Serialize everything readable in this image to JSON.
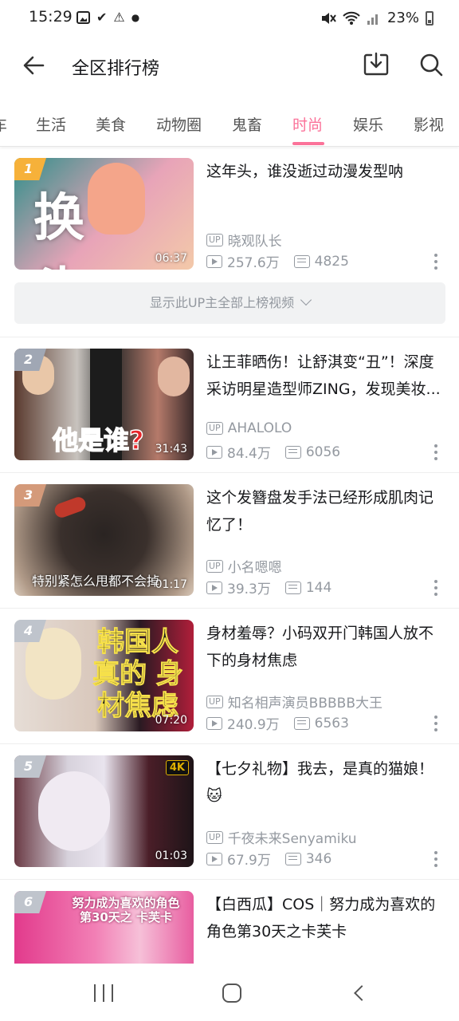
{
  "status_bar": {
    "time": "15:29",
    "battery": "23%",
    "icons": [
      "image-icon",
      "check-icon",
      "warning-icon",
      "dot-icon",
      "mute-icon",
      "wifi-icon",
      "signal-icon",
      "battery-icon"
    ]
  },
  "header": {
    "title": "全区排行榜"
  },
  "tabs": [
    {
      "label": "车",
      "active": false
    },
    {
      "label": "生活",
      "active": false
    },
    {
      "label": "美食",
      "active": false
    },
    {
      "label": "动物圈",
      "active": false
    },
    {
      "label": "鬼畜",
      "active": false
    },
    {
      "label": "时尚",
      "active": true
    },
    {
      "label": "娱乐",
      "active": false
    },
    {
      "label": "影视",
      "active": false
    }
  ],
  "show_all_label": "显示此UP主全部上榜视频",
  "up_badge": "UP",
  "videos": [
    {
      "rank": "1",
      "title": "这年头，谁没逝过动漫发型呐",
      "uploader": "晓观队长",
      "views": "257.6万",
      "danmaku": "4825",
      "duration": "06:37",
      "overlay_text": "换 头",
      "rank_color": "#f6b13a"
    },
    {
      "rank": "2",
      "title": "让王菲晒伤！让舒淇变“丑”！深度采访明星造型师ZING，发现美妆...",
      "uploader": "AHALOLO",
      "views": "84.4万",
      "danmaku": "6056",
      "duration": "31:43",
      "overlay_text": "他是谁?",
      "rank_color": "#a0a7b4"
    },
    {
      "rank": "3",
      "title": "这个发簪盘发手法已经形成肌肉记忆了！",
      "uploader": "小名嗯嗯",
      "views": "39.3万",
      "danmaku": "144",
      "duration": "01:17",
      "overlay_text": "特别紧怎么甩都不会掉",
      "rank_color": "#d49a7a"
    },
    {
      "rank": "4",
      "title": "身材羞辱？小码双开门韩国人放不下的身材焦虑",
      "uploader": "知名相声演员BBBBB大王",
      "views": "240.9万",
      "danmaku": "6563",
      "duration": "07:20",
      "overlay_text": "韩国人 真的 身材焦虑",
      "rank_color": "#bfc4cc"
    },
    {
      "rank": "5",
      "title": "【七夕礼物】我去，是真的猫娘！🐱",
      "uploader": "千夜未来Senyamiku",
      "views": "67.9万",
      "danmaku": "346",
      "duration": "01:03",
      "overlay_text": "4K",
      "rank_color": "#bfc4cc"
    },
    {
      "rank": "6",
      "title": "【白西瓜】COS｜努力成为喜欢的角色第30天之卡芙卡",
      "uploader": "",
      "views": "",
      "danmaku": "",
      "duration": "",
      "overlay_text": "努力成为喜欢的角色 第30天之 卡芙卡",
      "rank_color": "#bfc4cc"
    }
  ],
  "colors": {
    "accent": "#fb7299",
    "meta": "#9499a0"
  }
}
